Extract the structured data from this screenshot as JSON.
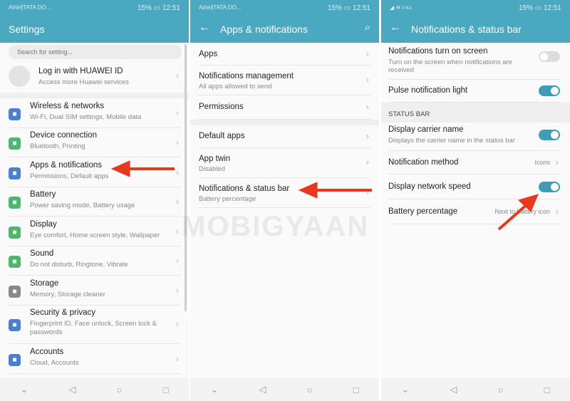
{
  "status": {
    "carrier": "Airtel|TATA DO...",
    "battery": "15%",
    "time": "12:51",
    "speed": "0 K/s"
  },
  "colors": {
    "accent": "#4aa9c1",
    "toggle_on": "#3d9db6",
    "arrow": "#e8391f"
  },
  "watermark": "MOBIGYAAN",
  "settings": {
    "title": "Settings",
    "search_placeholder": "Search for setting...",
    "account": {
      "title": "Log in with HUAWEI ID",
      "sub": "Access more Huawei services"
    },
    "items": [
      {
        "title": "Wireless & networks",
        "sub": "Wi-Fi, Dual SIM settings, Mobile data",
        "icon": "wifi-icon",
        "color": "#4a7fd4"
      },
      {
        "title": "Device connection",
        "sub": "Bluetooth, Printing",
        "icon": "device-connection-icon",
        "color": "#4cb86a"
      },
      {
        "title": "Apps & notifications",
        "sub": "Permissions, Default apps",
        "icon": "apps-icon",
        "color": "#4a7fd4"
      },
      {
        "title": "Battery",
        "sub": "Power saving mode, Battery usage",
        "icon": "battery-icon",
        "color": "#4cb86a"
      },
      {
        "title": "Display",
        "sub": "Eye comfort, Home screen style, Wallpaper",
        "icon": "display-icon",
        "color": "#4cb86a"
      },
      {
        "title": "Sound",
        "sub": "Do not disturb, Ringtone, Vibrate",
        "icon": "sound-icon",
        "color": "#4cb86a"
      },
      {
        "title": "Storage",
        "sub": "Memory, Storage cleaner",
        "icon": "storage-icon",
        "color": "#888888"
      },
      {
        "title": "Security & privacy",
        "sub": "Fingerprint ID, Face unlock, Screen lock &",
        "sub2": "passwords",
        "icon": "shield-icon",
        "color": "#4a7fd4"
      },
      {
        "title": "Accounts",
        "sub": "Cloud, Accounts",
        "icon": "accounts-icon",
        "color": "#4a7fd4"
      }
    ]
  },
  "apps": {
    "title": "Apps & notifications",
    "items": [
      {
        "title": "Apps"
      },
      {
        "title": "Notifications management",
        "sub": "All apps allowed to send"
      },
      {
        "title": "Permissions"
      },
      {
        "title": "Default apps"
      },
      {
        "title": "App twin",
        "sub": "Disabled"
      },
      {
        "title": "Notifications & status bar",
        "sub": "Battery percentage"
      }
    ]
  },
  "notif": {
    "title": "Notifications & status bar",
    "section": "STATUS BAR",
    "items": [
      {
        "title": "Notifications turn on screen",
        "sub": "Turn on the screen when notifications are",
        "sub2": "received",
        "toggle": false
      },
      {
        "title": "Pulse notification light",
        "toggle": true
      },
      {
        "title": "Display carrier name",
        "sub": "Displays the carrier name in the status bar",
        "toggle": true
      },
      {
        "title": "Notification method",
        "value": "Icons"
      },
      {
        "title": "Display network speed",
        "toggle": true
      },
      {
        "title": "Battery percentage",
        "value": "Next to battery icon"
      }
    ]
  }
}
